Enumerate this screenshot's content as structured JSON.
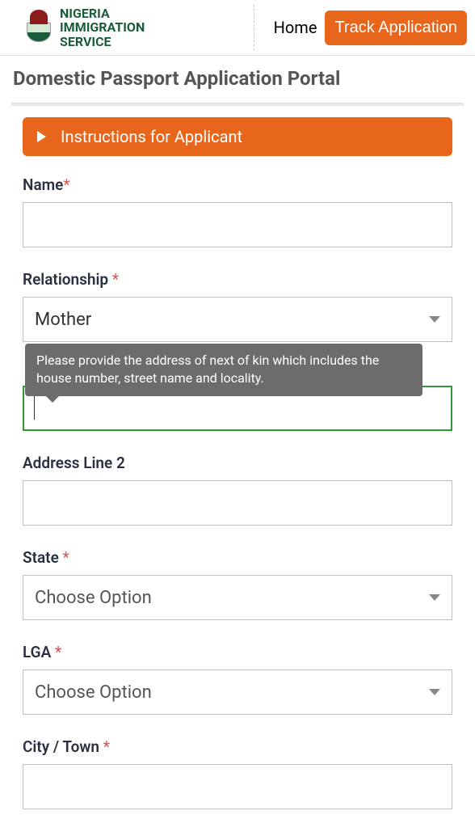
{
  "header": {
    "brand_line1": "NIGERIA",
    "brand_line2": "IMMIGRATION",
    "brand_line3": "SERVICE",
    "nav": {
      "home": "Home",
      "track": "Track Application"
    }
  },
  "page_title": "Domestic Passport Application Portal",
  "instructions_label": "Instructions for Applicant",
  "form": {
    "name": {
      "label": "Name",
      "required": "*",
      "value": ""
    },
    "relationship": {
      "label": "Relationship ",
      "required": "*",
      "value": "Mother"
    },
    "address1": {
      "tooltip": "Please provide the address of next of kin which includes the house number, street name and locality.",
      "value": ""
    },
    "address2": {
      "label": "Address Line 2",
      "value": ""
    },
    "state": {
      "label": "State ",
      "required": "*",
      "value": "Choose Option"
    },
    "lga": {
      "label": "LGA ",
      "required": "*",
      "value": "Choose Option"
    },
    "city": {
      "label": "City / Town ",
      "required": "*",
      "value": ""
    }
  }
}
